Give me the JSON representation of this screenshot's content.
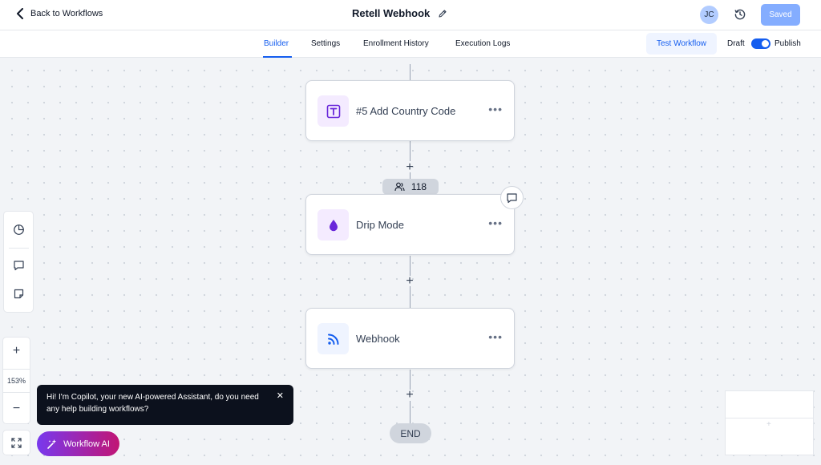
{
  "header": {
    "back_label": "Back to Workflows",
    "title": "Retell Webhook",
    "avatar_initials": "JC",
    "saved_label": "Saved"
  },
  "tabs": {
    "items": [
      {
        "label": "Builder",
        "active": true
      },
      {
        "label": "Settings",
        "active": false
      },
      {
        "label": "Enrollment History",
        "active": false
      },
      {
        "label": "Execution Logs",
        "active": false
      }
    ],
    "test_workflow_label": "Test Workflow",
    "draft_label": "Draft",
    "publish_label": "Publish",
    "published": true
  },
  "canvas": {
    "nodes": [
      {
        "label": "#5 Add Country Code",
        "icon": "text-formatter-icon",
        "icon_color": "#6927da",
        "icon_bg": "#f4ebff"
      },
      {
        "label": "Drip Mode",
        "icon": "drop-icon",
        "icon_color": "#6927da",
        "icon_bg": "#f4ebff"
      },
      {
        "label": "Webhook",
        "icon": "rss-feed-icon",
        "icon_color": "#155eef",
        "icon_bg": "#eff4ff"
      }
    ],
    "enrollment_count": "118",
    "end_label": "END"
  },
  "zoom": {
    "level": "153%"
  },
  "copilot": {
    "message": "Hi! I'm Copilot, your new AI-powered Assistant, do you need any help building workflows?",
    "button_label": "Workflow AI"
  },
  "colors": {
    "accent": "#155eef",
    "purple": "#6927da"
  }
}
